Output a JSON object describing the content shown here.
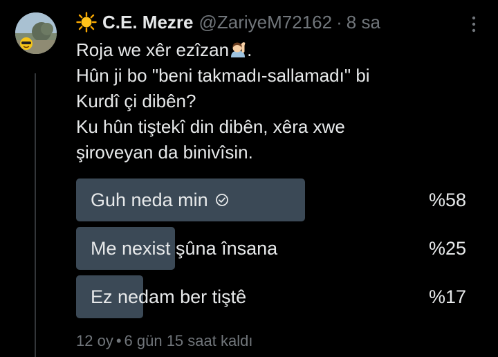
{
  "tweet": {
    "display_name": "C.E. Mezre",
    "handle": "@ZariyeM72162",
    "separator": "·",
    "time": "8 sa",
    "avatar_icon": "avatar-landscape",
    "name_icon": "sun-icon",
    "text_line1": "Roja we xêr ezîzan",
    "text_line1_end": ".",
    "text_rest": "Hûn ji bo \"beni takmadı-sallamadı\" bi\nKurdî çi dibên?\nKu hûn tiştekî din dibên, xêra xwe\nşiroveyan da binivîsin."
  },
  "poll": {
    "options": [
      {
        "label": "Guh neda min",
        "percent_text": "%58",
        "value": 58,
        "selected": true
      },
      {
        "label": "Me nexist şûna însana",
        "percent_text": "%25",
        "value": 25,
        "selected": false
      },
      {
        "label": "Ez nedam ber tiştê",
        "percent_text": "%17",
        "value": 17,
        "selected": false
      }
    ],
    "votes": "12 oy",
    "separator": "•",
    "time_left": "6 gün 15 saat kaldı",
    "bar_color": "#3b4956"
  },
  "colors": {
    "background": "#000000",
    "text": "#e7e9ea",
    "muted": "#71767b"
  }
}
